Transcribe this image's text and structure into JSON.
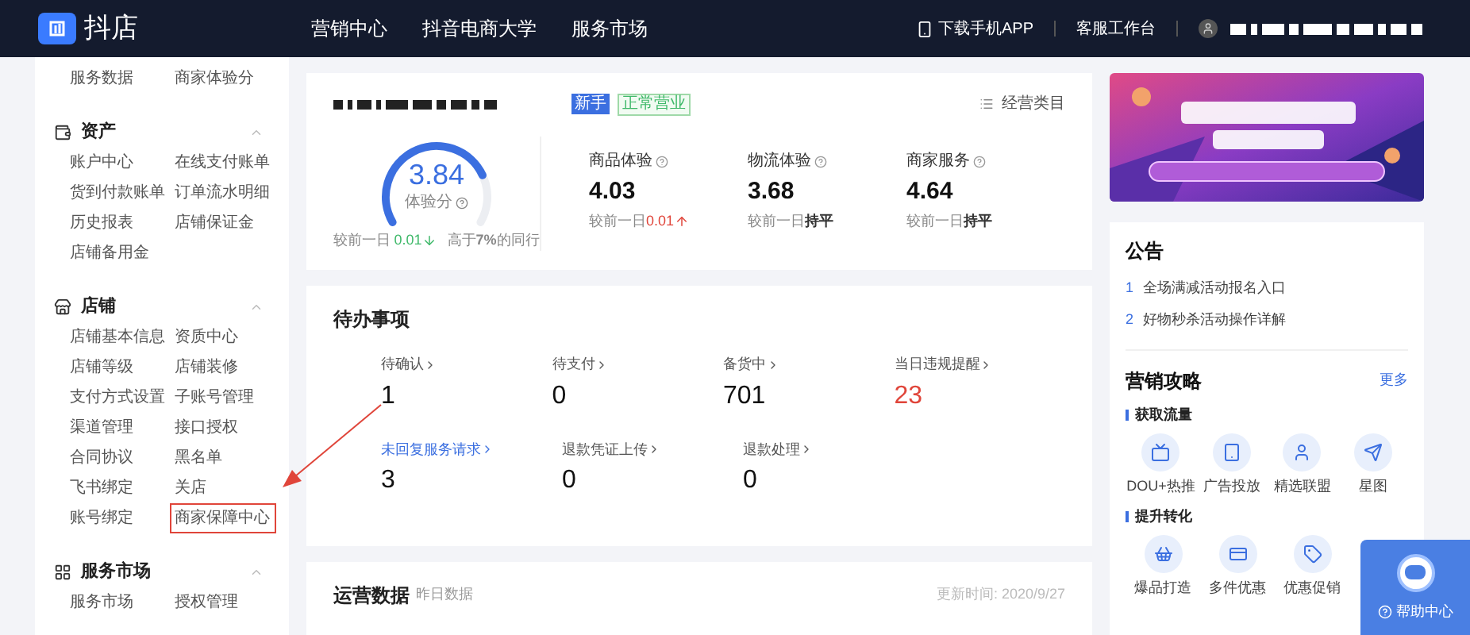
{
  "header": {
    "logo": "抖店",
    "nav": [
      {
        "label": "营销中心"
      },
      {
        "label": "抖音电商大学"
      },
      {
        "label": "服务市场"
      }
    ],
    "download": "下载手机APP",
    "service": "客服工作台"
  },
  "sidebar": {
    "top_items": [
      "服务数据",
      "商家体验分"
    ],
    "sections": [
      {
        "title": "资产",
        "expanded": true,
        "items": [
          {
            "label": "账户中心",
            "highlighted": false
          },
          {
            "label": "在线支付账单",
            "highlighted": false
          },
          {
            "label": "货到付款账单",
            "highlighted": false
          },
          {
            "label": "订单流水明细",
            "highlighted": false
          },
          {
            "label": "历史报表",
            "highlighted": false
          },
          {
            "label": "店铺保证金",
            "highlighted": false
          },
          {
            "label": "店铺备用金",
            "highlighted": false
          }
        ]
      },
      {
        "title": "店铺",
        "expanded": true,
        "items": [
          {
            "label": "店铺基本信息",
            "highlighted": false
          },
          {
            "label": "资质中心",
            "highlighted": false
          },
          {
            "label": "店铺等级",
            "highlighted": false
          },
          {
            "label": "店铺装修",
            "highlighted": false
          },
          {
            "label": "支付方式设置",
            "highlighted": false
          },
          {
            "label": "子账号管理",
            "highlighted": false
          },
          {
            "label": "渠道管理",
            "highlighted": false
          },
          {
            "label": "接口授权",
            "highlighted": false
          },
          {
            "label": "合同协议",
            "highlighted": false
          },
          {
            "label": "黑名单",
            "highlighted": false
          },
          {
            "label": "飞书绑定",
            "highlighted": false
          },
          {
            "label": "关店",
            "highlighted": false
          },
          {
            "label": "账号绑定",
            "highlighted": false
          },
          {
            "label": "商家保障中心",
            "highlighted": true
          }
        ]
      },
      {
        "title": "服务市场",
        "expanded": true,
        "items": [
          {
            "label": "服务市场",
            "highlighted": false
          },
          {
            "label": "授权管理",
            "highlighted": false
          }
        ]
      }
    ]
  },
  "score_card": {
    "badges": [
      {
        "label": "新手",
        "kind": "solid"
      },
      {
        "label": "正常营业",
        "kind": "outline"
      }
    ],
    "category_link": "经营类目",
    "score": {
      "value": "3.84",
      "label": "体验分",
      "level": 0.77,
      "change_prefix": "较前一日",
      "change": "0.01",
      "kind": "down",
      "peer": "高于**7%**的同行"
    },
    "metrics": [
      {
        "label": "商品体验",
        "value": "4.03",
        "change_prefix": "较前一日",
        "change": "0.01",
        "kind": "up"
      },
      {
        "label": "物流体验",
        "value": "3.68",
        "change_prefix": "较前一日",
        "change": "持平",
        "kind": "flat"
      },
      {
        "label": "商家服务",
        "value": "4.64",
        "change_prefix": "较前一日",
        "change": "持平",
        "kind": "flat"
      }
    ]
  },
  "todo": {
    "title": "待办事项",
    "rows": [
      [
        {
          "label": "待确认",
          "value": "1",
          "kind": "normal"
        },
        {
          "label": "待支付",
          "value": "0",
          "kind": "normal"
        },
        {
          "label": "备货中",
          "value": "701",
          "kind": "normal"
        },
        {
          "label": "当日违规提醒",
          "value": "23",
          "kind": "alert"
        }
      ],
      [
        {
          "label": "未回复服务请求",
          "value": "3",
          "kind": "link"
        },
        {
          "label": "退款凭证上传",
          "value": "0",
          "kind": "normal"
        },
        {
          "label": "退款处理",
          "value": "0",
          "kind": "normal"
        }
      ]
    ]
  },
  "operations": {
    "title": "运营数据",
    "subtitle": "昨日数据",
    "updated": "更新时间: 2020/9/27"
  },
  "announcements": {
    "title": "公告",
    "items": [
      {
        "index": "1",
        "text": "全场满减活动报名入口"
      },
      {
        "index": "2",
        "text": "好物秒杀活动操作详解"
      }
    ]
  },
  "marketing": {
    "title": "营销攻略",
    "more": "更多",
    "groups": [
      {
        "title": "获取流量",
        "items": [
          {
            "label": "DOU+热推"
          },
          {
            "label": "广告投放"
          },
          {
            "label": "精选联盟"
          },
          {
            "label": "星图"
          }
        ]
      },
      {
        "title": "提升转化",
        "items": [
          {
            "label": "爆品打造"
          },
          {
            "label": "多件优惠"
          },
          {
            "label": "优惠促销"
          }
        ]
      }
    ]
  },
  "help": {
    "label": "帮助中心"
  }
}
